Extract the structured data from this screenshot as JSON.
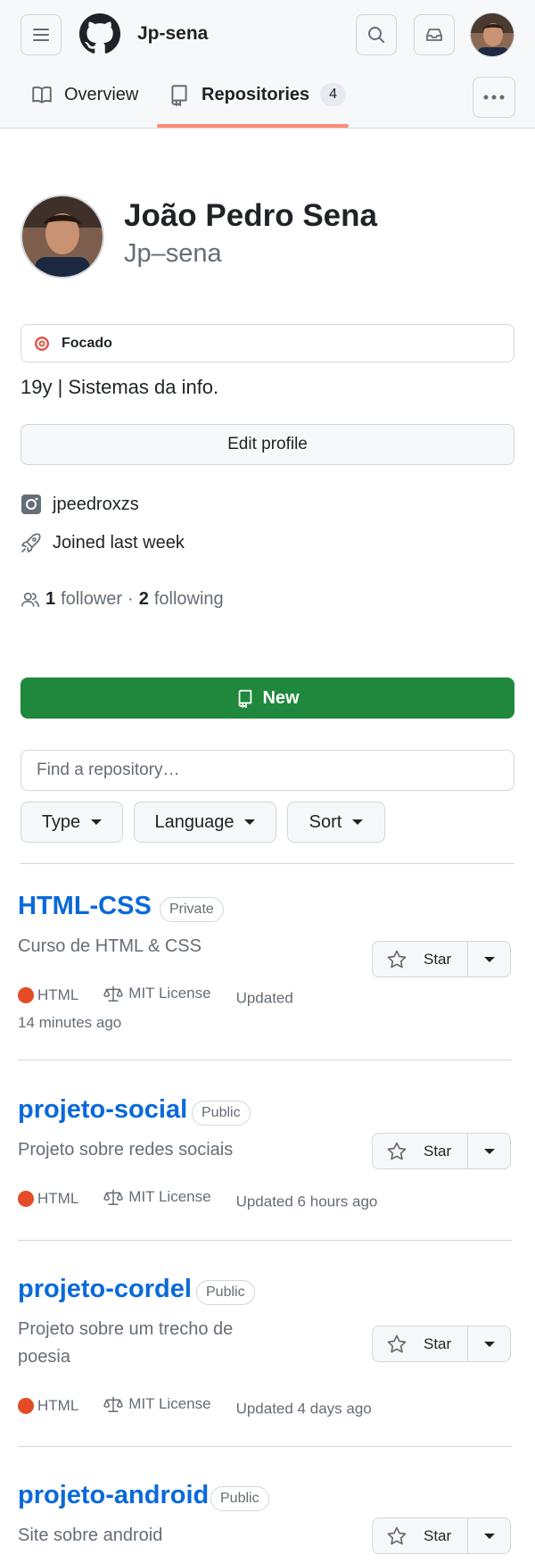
{
  "header": {
    "username": "Jp-sena",
    "tabs": [
      {
        "label": "Overview"
      },
      {
        "label": "Repositories",
        "count": "4"
      }
    ]
  },
  "profile": {
    "fullname": "João Pedro Sena",
    "login": "Jp–sena",
    "status": "Focado",
    "bio": "19y | Sistemas da info.",
    "edit_label": "Edit profile",
    "instagram": "jpeedroxzs",
    "joined": "Joined last week",
    "followers_count": "1",
    "followers_label": "follower",
    "following_count": "2",
    "following_label": "following",
    "separator": "·"
  },
  "repo_controls": {
    "new_label": "New",
    "search_placeholder": "Find a repository…",
    "type_label": "Type",
    "language_label": "Language",
    "sort_label": "Sort"
  },
  "repos": [
    {
      "name": "HTML-CSS",
      "visibility": "Private",
      "description": "Curso de HTML & CSS",
      "language": "HTML",
      "license": "MIT License",
      "updated": "Updated",
      "updated_2": "14 minutes ago",
      "star_label": "Star"
    },
    {
      "name": "projeto-social",
      "visibility": "Public",
      "description": "Projeto sobre redes sociais",
      "language": "HTML",
      "license": "MIT License",
      "updated": "Updated 6 hours ago",
      "star_label": "Star"
    },
    {
      "name": "projeto-cordel",
      "visibility": "Public",
      "description": "Projeto sobre um trecho de",
      "description_2": "poesia",
      "language": "HTML",
      "license": "MIT License",
      "updated": "Updated 4 days ago",
      "star_label": "Star"
    },
    {
      "name": "projeto-android",
      "visibility": "Public",
      "description": "Site sobre android",
      "star_label": "Star"
    }
  ],
  "colors": {
    "accent": "#0969da",
    "new_button": "#1f883d",
    "html_language": "#e34c26",
    "tab_underline": "#fd8c73"
  },
  "icons": [
    "menu-icon",
    "github-logo-icon",
    "search-icon",
    "inbox-icon",
    "book-icon",
    "repo-icon",
    "kebab-icon",
    "instagram-icon",
    "rocket-icon",
    "people-icon",
    "star-icon",
    "law-icon"
  ]
}
